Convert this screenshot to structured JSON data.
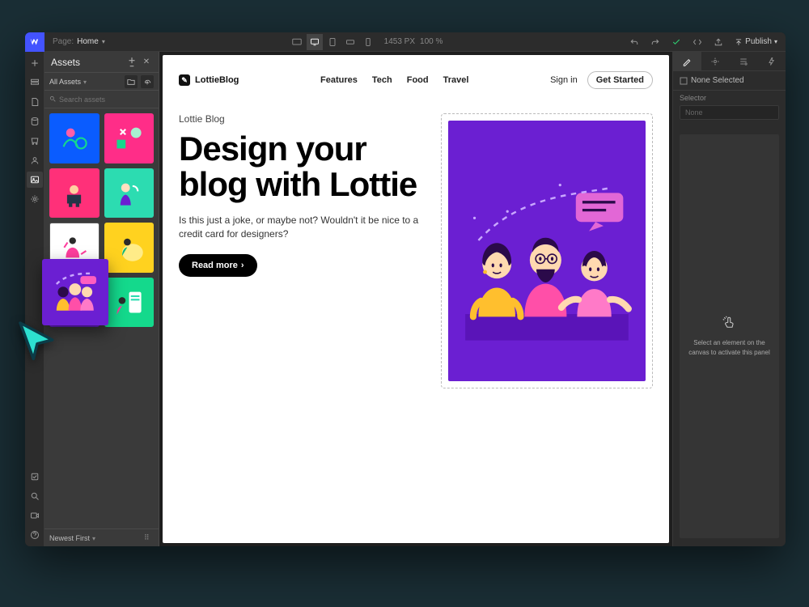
{
  "topbar": {
    "page_label": "Page:",
    "page_name": "Home",
    "width_px": "1453 PX",
    "zoom": "100 %",
    "publish_label": "Publish"
  },
  "assets": {
    "title": "Assets",
    "filter_label": "All Assets",
    "search_placeholder": "Search assets",
    "sort_label": "Newest First"
  },
  "site": {
    "brand": "LottieBlog",
    "nav_items": [
      "Features",
      "Tech",
      "Food",
      "Travel"
    ],
    "sign_in": "Sign in",
    "get_started": "Get Started",
    "hero_kicker": "Lottie Blog",
    "hero_title": "Design your blog with Lottie",
    "hero_sub": "Is this just a joke, or maybe not? Wouldn't it be nice to a credit card for designers?",
    "read_more": "Read more"
  },
  "right_panel": {
    "none_selected": "None Selected",
    "selector_label": "Selector",
    "selector_value": "None",
    "empty_msg": "Select an element on the canvas to activate this panel"
  },
  "asset_colors": [
    "#0a5cff",
    "#ff2d88",
    "#ff3079",
    "#2cdcb1",
    "#ffffff",
    "#ffd21f",
    "#6b1fd2",
    "#14d98c"
  ],
  "left_rail_icons": [
    "add",
    "layers",
    "pages",
    "cms",
    "ecom",
    "users",
    "assets",
    "settings"
  ]
}
